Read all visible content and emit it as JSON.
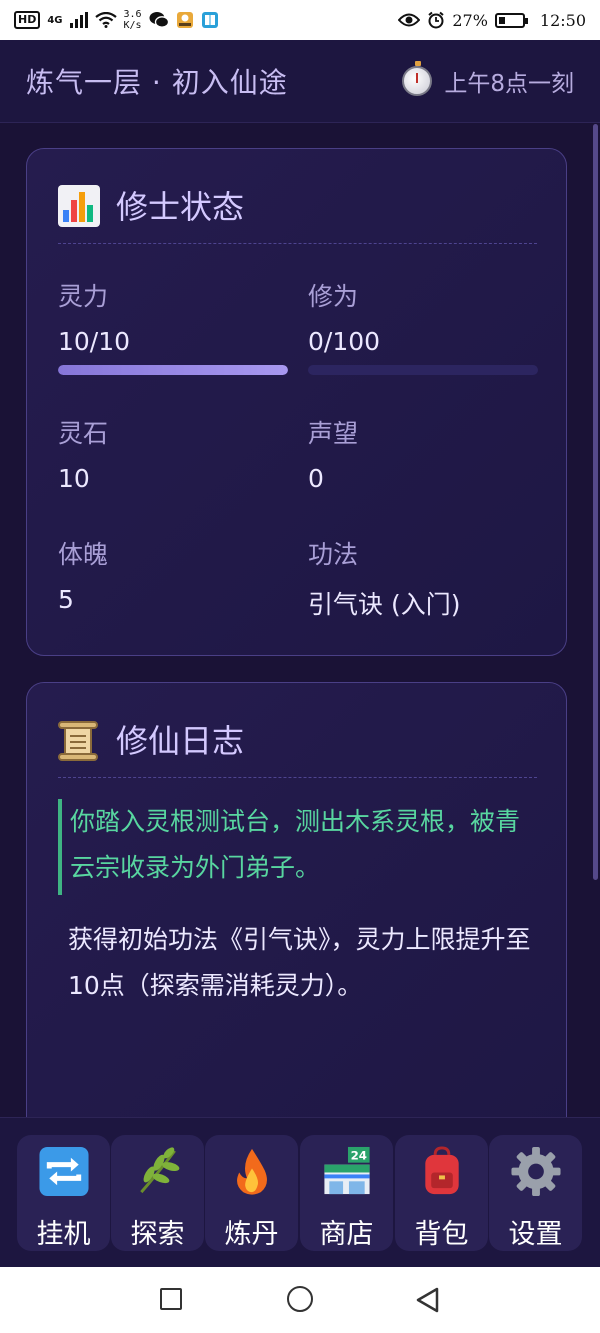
{
  "status_bar": {
    "network_badge": "HD",
    "signal_type": "4G",
    "net_speed_value": "3.6",
    "net_speed_unit": "K/s",
    "battery_percent_text": "27%",
    "battery_level": 0.27,
    "time": "12:50"
  },
  "header": {
    "realm": "炼气一层 · 初入仙途",
    "game_time": "上午8点一刻"
  },
  "status_card": {
    "title": "修士状态",
    "icon": "bar-chart-icon",
    "stats": {
      "spirit_power": {
        "label": "灵力",
        "value": "10/10",
        "fraction": 1.0
      },
      "cultivation": {
        "label": "修为",
        "value": "0/100",
        "fraction": 0.0
      },
      "spirit_stone": {
        "label": "灵石",
        "value": "10"
      },
      "reputation": {
        "label": "声望",
        "value": "0"
      },
      "physique": {
        "label": "体魄",
        "value": "5"
      },
      "technique": {
        "label": "功法",
        "value": "引气诀 (入门)"
      }
    }
  },
  "log_card": {
    "title": "修仙日志",
    "icon": "scroll-icon",
    "highlight_entry": "你踏入灵根测试台，测出木系灵根，被青云宗收录为外门弟子。",
    "entries": [
      "获得初始功法《引气诀》，灵力上限提升至10点（探索需消耗灵力）。"
    ]
  },
  "nav": [
    {
      "label": "挂机",
      "icon": "repeat-arrows-icon"
    },
    {
      "label": "探索",
      "icon": "herb-icon"
    },
    {
      "label": "炼丹",
      "icon": "fire-icon"
    },
    {
      "label": "商店",
      "icon": "convenience-store-icon"
    },
    {
      "label": "背包",
      "icon": "backpack-icon"
    },
    {
      "label": "设置",
      "icon": "gear-icon"
    }
  ],
  "colors": {
    "background": "#1a1236",
    "accent": "#8676d8",
    "log_highlight": "#58d6a0"
  }
}
